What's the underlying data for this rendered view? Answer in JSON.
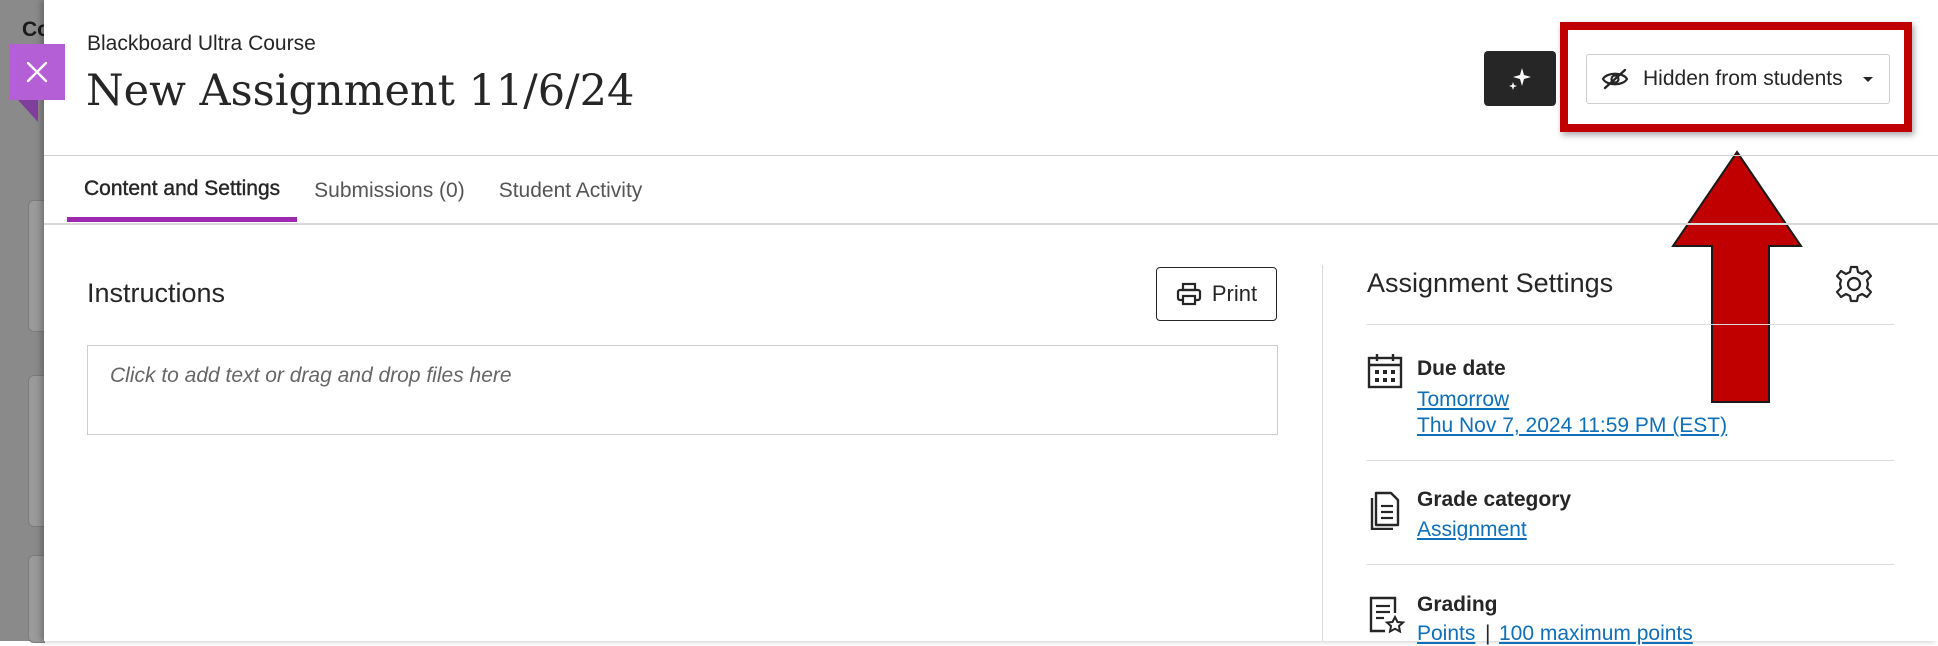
{
  "backdrop": {
    "partial_text": "Co"
  },
  "header": {
    "course_name": "Blackboard Ultra Course",
    "title": "New Assignment 11/6/24",
    "visibility": {
      "label": "Hidden from students",
      "icon": "eye-slash-icon"
    },
    "ai_button_icon": "sparkle-icon",
    "close_icon": "close-icon"
  },
  "tabs": [
    {
      "label": "Content and Settings",
      "active": true
    },
    {
      "label": "Submissions (0)",
      "active": false
    },
    {
      "label": "Student Activity",
      "active": false
    }
  ],
  "instructions": {
    "heading": "Instructions",
    "print_label": "Print",
    "placeholder": "Click to add text or drag and drop files here"
  },
  "settings": {
    "heading": "Assignment Settings",
    "due_date": {
      "label": "Due date",
      "relative": "Tomorrow",
      "date": "Thu Nov 7, 2024 11:59 PM (EST)"
    },
    "grade_category": {
      "label": "Grade category",
      "value": "Assignment"
    },
    "grading": {
      "label": "Grading",
      "schema": "Points",
      "separator": "|",
      "max_points": "100 maximum points"
    }
  },
  "annotation": {
    "highlight_color": "#c00000",
    "arrow_color": "#c00000"
  },
  "colors": {
    "accent": "#9c27b0",
    "close_tab": "#b45fd6",
    "link": "#0f6fb8"
  }
}
